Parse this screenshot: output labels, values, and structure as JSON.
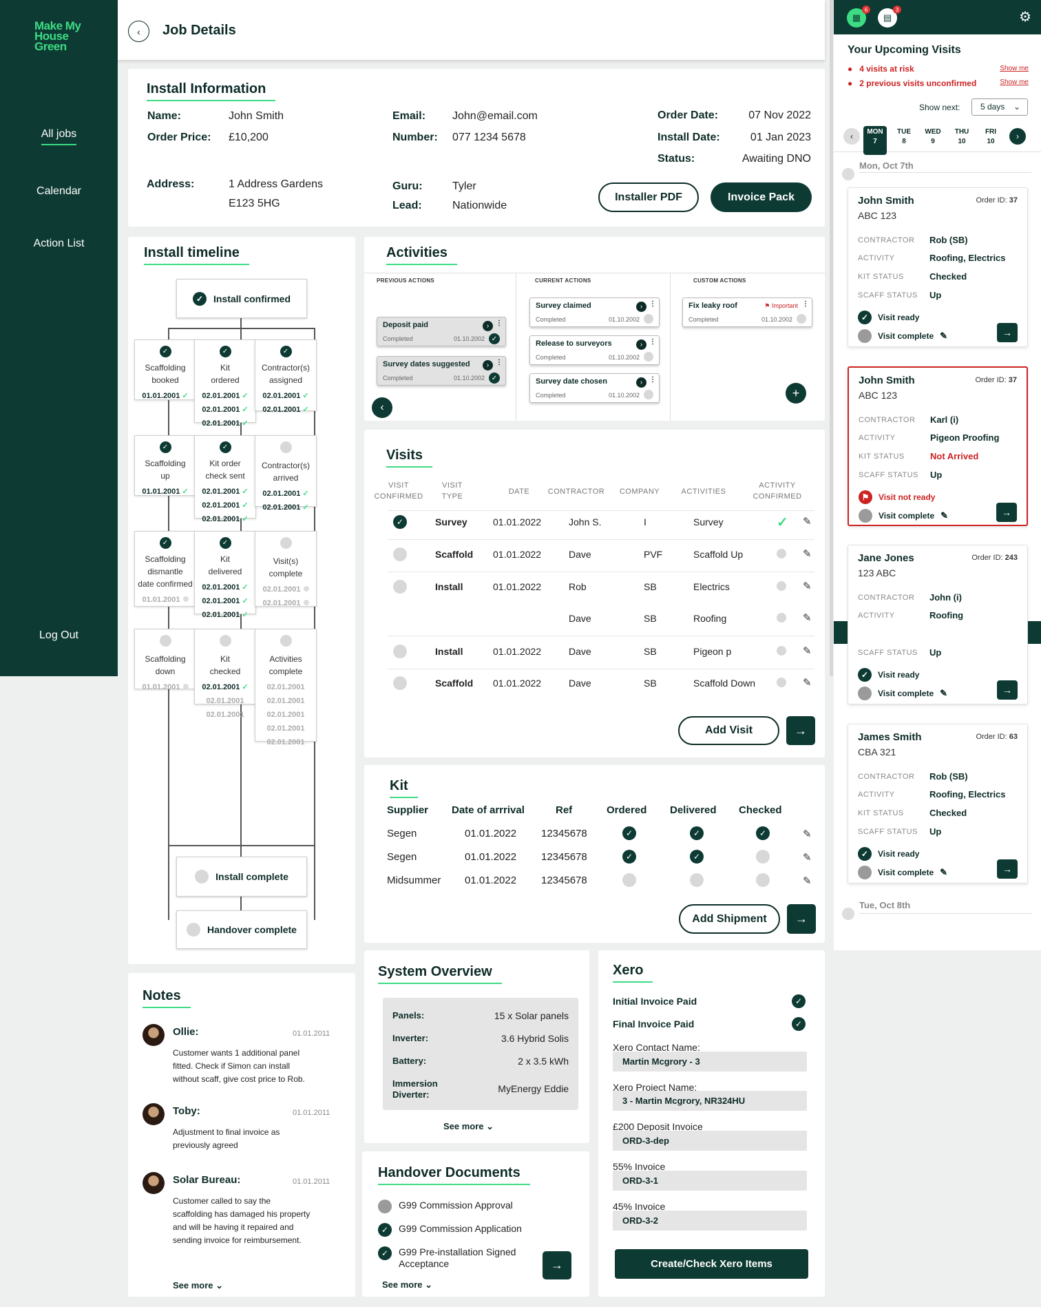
{
  "brand": {
    "logo_lines": [
      "Make My",
      "House",
      "Green"
    ]
  },
  "nav": {
    "items": [
      "All jobs",
      "Calendar",
      "Action List"
    ],
    "logout": "Log Out"
  },
  "header": {
    "title": "Job Details"
  },
  "install_info": {
    "title": "Install Information",
    "name_label": "Name:",
    "name": "John Smith",
    "price_label": "Order Price:",
    "price": "£10,200",
    "address_label": "Address:",
    "address1": "1 Address Gardens",
    "address2": "E123 5HG",
    "email_label": "Email:",
    "email": "John@email.com",
    "number_label": "Number:",
    "number": "077 1234 5678",
    "guru_label": "Guru:",
    "guru": "Tyler",
    "lead_label": "Lead:",
    "lead": "Nationwide",
    "order_date_label": "Order Date:",
    "order_date": "07 Nov 2022",
    "install_date_label": "Install Date:",
    "install_date": "01 Jan 2023",
    "status_label": "Status:",
    "status": "Awaiting DNO",
    "installer_pdf": "Installer PDF",
    "invoice_pack": "Invoice Pack"
  },
  "timeline": {
    "title": "Install timeline",
    "confirmed": "Install confirmed",
    "complete": "Install complete",
    "handover": "Handover complete",
    "nodes": [
      {
        "l1": "Scaffolding",
        "l2": "booked",
        "dates": [
          "01.01.2001"
        ]
      },
      {
        "l1": "Kit",
        "l2": "ordered",
        "dates": [
          "02.01.2001",
          "02.01.2001",
          "02.01.2001"
        ]
      },
      {
        "l1": "Contractor(s)",
        "l2": "assigned",
        "dates": [
          "02.01.2001",
          "02.01.2001"
        ]
      },
      {
        "l1": "Scaffolding",
        "l2": "up",
        "dates": [
          "01.01.2001"
        ]
      },
      {
        "l1": "Kit order",
        "l2": "check sent",
        "dates": [
          "02.01.2001",
          "02.01.2001",
          "02.01.2001"
        ]
      },
      {
        "l1": "Contractor(s)",
        "l2": "arrived",
        "dates": [
          "02.01.2001",
          "02.01.2001"
        ]
      },
      {
        "l1": "Scaffolding",
        "l2": "dismantle",
        "l3": "date confirmed",
        "dates": [
          "01.01.2001"
        ]
      },
      {
        "l1": "Kit",
        "l2": "delivered",
        "dates": [
          "02.01.2001",
          "02.01.2001",
          "02.01.2001"
        ]
      },
      {
        "l1": "Visit(s)",
        "l2": "complete",
        "dates": [
          "02.01.2001",
          "02.01.2001"
        ]
      },
      {
        "l1": "Scaffolding",
        "l2": "down",
        "dates": [
          "01.01.2001"
        ]
      },
      {
        "l1": "Kit",
        "l2": "checked",
        "dates": [
          "02.01.2001",
          "02.01.2001",
          "02.01.2001"
        ]
      },
      {
        "l1": "Activities",
        "l2": "complete",
        "dates": [
          "02.01.2001",
          "02.01.2001",
          "02.01.2001",
          "02.01.2001",
          "02.01.2001"
        ]
      }
    ]
  },
  "activities": {
    "title": "Activities",
    "previous_h": "PREVIOUS ACTIONS",
    "current_h": "CURRENT ACTIONS",
    "custom_h": "CUSTOM ACTIONS",
    "previous": [
      {
        "t": "Deposit paid",
        "s": "Completed",
        "d": "01.10.2002"
      },
      {
        "t": "Survey dates suggested",
        "s": "Completed",
        "d": "01.10.2002"
      }
    ],
    "current": [
      {
        "t": "Survey claimed",
        "s": "Completed",
        "d": "01.10.2002"
      },
      {
        "t": "Release to surveyors",
        "s": "Completed",
        "d": "01.10.2002"
      },
      {
        "t": "Survey date chosen",
        "s": "Completed",
        "d": "01.10.2002"
      }
    ],
    "custom": [
      {
        "t": "Fix leaky roof",
        "s": "Completed",
        "d": "01.10.2002",
        "flag": "Important"
      }
    ]
  },
  "visits": {
    "title": "Visits",
    "headers": [
      "VISIT CONFIRMED",
      "VISIT TYPE",
      "DATE",
      "CONTRACTOR",
      "COMPANY",
      "ACTIVITIES",
      "ACTIVITY CONFIRMED"
    ],
    "rows": [
      {
        "type": "Survey",
        "date": "01.01.2022",
        "contractor": "John S.",
        "company": "I",
        "activity": "Survey"
      },
      {
        "type": "Scaffold",
        "date": "01.01.2022",
        "contractor": "Dave",
        "company": "PVF",
        "activity": "Scaffold Up"
      },
      {
        "type": "Install",
        "date": "01.01.2022",
        "contractor": "Rob",
        "company": "SB",
        "activity": "Electrics"
      },
      {
        "type": "",
        "date": "",
        "contractor": "Dave",
        "company": "SB",
        "activity": "Roofing"
      },
      {
        "type": "Install",
        "date": "01.01.2022",
        "contractor": "Dave",
        "company": "SB",
        "activity": "Pigeon p"
      },
      {
        "type": "Scaffold",
        "date": "01.01.2022",
        "contractor": "Dave",
        "company": "SB",
        "activity": "Scaffold Down"
      }
    ],
    "add": "Add Visit"
  },
  "kit": {
    "title": "Kit",
    "headers": [
      "Supplier",
      "Date of arrrival",
      "Ref",
      "Ordered",
      "Delivered",
      "Checked"
    ],
    "rows": [
      {
        "supplier": "Segen",
        "date": "01.01.2022",
        "ref": "12345678"
      },
      {
        "supplier": "Segen",
        "date": "01.01.2022",
        "ref": "12345678"
      },
      {
        "supplier": "Midsummer",
        "date": "01.01.2022",
        "ref": "12345678"
      }
    ],
    "add": "Add Shipment"
  },
  "notes": {
    "title": "Notes",
    "items": [
      {
        "name": "Ollie:",
        "date": "01.01.2011",
        "l": [
          "Customer wants 1 additional panel",
          "fitted. Check if Simon can install",
          "without scaff, give cost price to Rob."
        ]
      },
      {
        "name": "Toby:",
        "date": "01.01.2011",
        "l": [
          "Adjustment to final invoice as",
          "previously agreed"
        ]
      },
      {
        "name": "Solar Bureau:",
        "date": "01.01.2011",
        "l": [
          "Customer called to say the",
          "scaffolding has damaged his property",
          "and will be having it repaired and",
          "sending invoice for reimbursement."
        ]
      }
    ],
    "see_more": "See more"
  },
  "system": {
    "title": "System Overview",
    "rows": [
      {
        "k": "Panels:",
        "v": "15 x Solar panels"
      },
      {
        "k": "Inverter:",
        "v": "3.6 Hybrid Solis"
      },
      {
        "k": "Battery:",
        "v": "2 x 3.5 kWh"
      },
      {
        "k": "Immersion",
        "k2": "Diverter:",
        "v": "MyEnergy Eddie"
      }
    ],
    "see_more": "See more"
  },
  "handover": {
    "title": "Handover Documents",
    "docs": [
      "G99 Commission Approval",
      "G99 Commission Application",
      "G99 Pre-installation Signed",
      "Acceptance"
    ],
    "see_more": "See more"
  },
  "xero": {
    "title": "Xero",
    "initial": "Initial Invoice Paid",
    "final": "Final Invoice Paid",
    "contact_label": "Xero Contact Name:",
    "contact": "Martin Mcgrory - 3",
    "project_label": "Xero Project Name:",
    "project": "3 - Martin Mcgrory, NR324HU",
    "deposit_label": "£200 Deposit Invoice",
    "deposit": "ORD-3-dep",
    "inv55_label": "55% Invoice",
    "inv55": "ORD-3-1",
    "inv45_label": "45% Invoice",
    "inv45": "ORD-3-2",
    "create": "Create/Check Xero Items"
  },
  "upcoming": {
    "badge1": "6",
    "badge2": "3",
    "title": "Your Upcoming Visits",
    "risk": "4 visits at risk",
    "unconfirmed": "2 previous visits unconfirmed",
    "show_me": "Show me",
    "show_next_label": "Show next:",
    "show_next": "5 days",
    "days": [
      {
        "d": "MON",
        "n": "7"
      },
      {
        "d": "TUE",
        "n": "8"
      },
      {
        "d": "WED",
        "n": "9"
      },
      {
        "d": "THU",
        "n": "10"
      },
      {
        "d": "FRI",
        "n": "10"
      }
    ],
    "date1": "Mon, Oct 7th",
    "date2": "Tue, Oct 8th",
    "contractor_l": "CONTRACTOR",
    "activity_l": "ACTIVITY",
    "kit_l": "KIT STATUS",
    "scaff_l": "SCAFF STATUS",
    "order_l": "Order ID:",
    "cards": [
      {
        "name": "John Smith",
        "sub": "ABC 123",
        "oid": "37",
        "contractor": "Rob (SB)",
        "activity": "Roofing, Electrics",
        "kit": "Checked",
        "scaff": "Up",
        "ready": "Visit ready",
        "complete": "Visit complete"
      },
      {
        "name": "John Smith",
        "sub": "ABC 123",
        "oid": "37",
        "contractor": "Karl (i)",
        "activity": "Pigeon Proofing",
        "kit": "Not Arrived",
        "scaff": "Up",
        "ready": "Visit not ready",
        "complete": "Visit complete"
      },
      {
        "name": "Jane Jones",
        "sub": "123 ABC",
        "oid": "243",
        "contractor": "John (i)",
        "activity": "Roofing",
        "kit": "",
        "scaff": "Up",
        "ready": "Visit ready",
        "complete": "Visit complete"
      },
      {
        "name": "James Smith",
        "sub": "CBA 321",
        "oid": "63",
        "contractor": "Rob (SB)",
        "activity": "Roofing, Electrics",
        "kit": "Checked",
        "scaff": "Up",
        "ready": "Visit ready",
        "complete": "Visit complete"
      }
    ]
  }
}
